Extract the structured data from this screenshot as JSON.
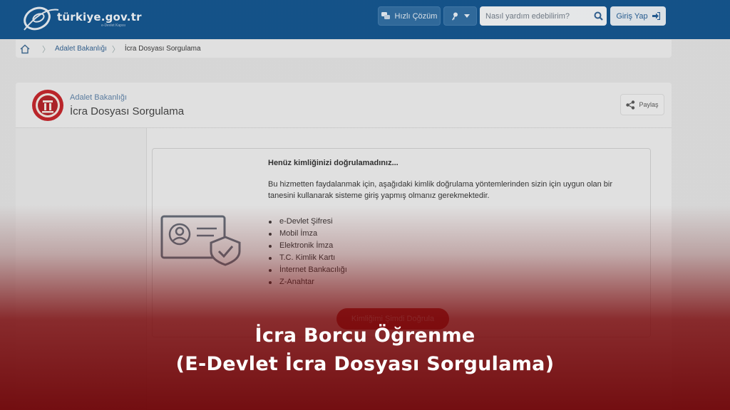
{
  "header": {
    "logo_text": "türkiye.gov.tr",
    "logo_sub": "e-Devlet Kapısı",
    "quick_solution_label": "Hızlı Çözüm",
    "search_placeholder": "Nasıl yardım edebilirim?",
    "login_label": "Giriş Yap",
    "icons": {
      "quick": "chat-bubbles-icon",
      "key": "key-icon",
      "caret": "caret-down-icon",
      "search": "search-icon",
      "login": "sign-in-icon"
    }
  },
  "breadcrumb": {
    "items": [
      "Adalet Bakanlığı",
      "İcra Dosyası Sorgulama"
    ],
    "home_icon": "home-icon"
  },
  "service": {
    "institution": "Adalet Bakanlığı",
    "title": "İcra Dosyası Sorgulama",
    "share_label": "Paylaş"
  },
  "notice": {
    "title": "Henüz kimliğinizi doğrulamadınız...",
    "description": "Bu hizmetten faydalanmak için, aşağıdaki kimlik doğrulama yöntemlerinden sizin için uygun olan bir tanesini kullanarak sisteme giriş yapmış olmanız gerekmektedir.",
    "methods": [
      "e-Devlet Şifresi",
      "Mobil İmza",
      "Elektronik İmza",
      "T.C. Kimlik Kartı",
      "İnternet Bankacılığı",
      "Z-Anahtar"
    ],
    "verify_button": "Kimliğimi Şimdi Doğrula"
  },
  "banner": {
    "line1": "İcra Borcu Öğrenme",
    "line2": "(E-Devlet İcra Dosyası Sorgulama)"
  },
  "colors": {
    "header_bg": "#0c508c",
    "accent_red": "#a52324",
    "banner_red": "#7a0608"
  }
}
